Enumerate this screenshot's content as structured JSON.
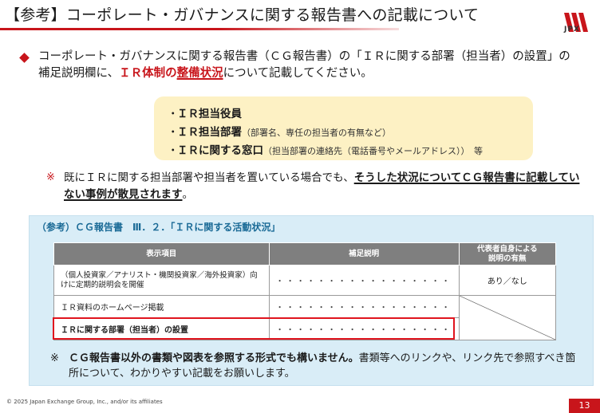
{
  "header": {
    "title": "【参考】コーポレート・ガバナンスに関する報告書への記載について",
    "logo_text": "JPX"
  },
  "main": {
    "text_1": "コーポレート・ガバナンスに関する報告書（ＣＧ報告書）の「ＩＲに関する部署（担当者）の設置」の補足説明欄に、",
    "text_highlight_a": "ＩＲ体制の",
    "text_highlight_b": "整備状況",
    "text_2": "について記載してください。"
  },
  "callout": {
    "items": [
      {
        "bullet": "・",
        "label": "ＩＲ担当役員",
        "sub": ""
      },
      {
        "bullet": "・",
        "label": "ＩＲ担当部署",
        "sub": "（部署名、専任の担当者の有無など）"
      },
      {
        "bullet": "・",
        "label": "ＩＲに関する窓口",
        "sub": "（担当部署の連絡先（電話番号やメールアドレス））　等"
      }
    ]
  },
  "note": {
    "mark": "※",
    "text_1": "既にＩＲに関する担当部署や担当者を置いている場合でも、",
    "text_em": "そうした状況についてＣＧ報告書に記載していない事例が散見されます",
    "text_2": "。"
  },
  "reference": {
    "title": "（参考）ＣＧ報告書　Ⅲ．２．「ＩＲに関する活動状況」",
    "table": {
      "headers": [
        "表示項目",
        "補足説明",
        "代表者自身による\n説明の有無"
      ],
      "rows": [
        {
          "item": "（個人投資家／アナリスト・機関投資家／海外投資家）向けに定期的説明会を開催",
          "note": "・・・・・・・・・・・・・・・・・",
          "rep": "あり／なし"
        },
        {
          "item": "ＩＲ資料のホームページ掲載",
          "note": "・・・・・・・・・・・・・・・・・",
          "rep": ""
        },
        {
          "item": "ＩＲに関する部署（担当者）の設置",
          "note": "・・・・・・・・・・・・・・・・・",
          "rep": ""
        }
      ]
    }
  },
  "bottom_note": {
    "mark": "※",
    "text_bold": "ＣＧ報告書以外の書類や図表を参照する形式でも構いません。",
    "text_rest": "書類等へのリンクや、リンク先で参照すべき箇所について、わかりやすい記載をお願いします。"
  },
  "footer": {
    "copyright": "© 2025 Japan Exchange Group, Inc., and/or its affiliates",
    "page_number": "13"
  },
  "colors": {
    "accent_red": "#c8151b",
    "callout_bg": "#fdf1c4",
    "panel_bg": "#d9edf7",
    "ref_title": "#1a6a96",
    "table_header": "#7f7f7f"
  }
}
